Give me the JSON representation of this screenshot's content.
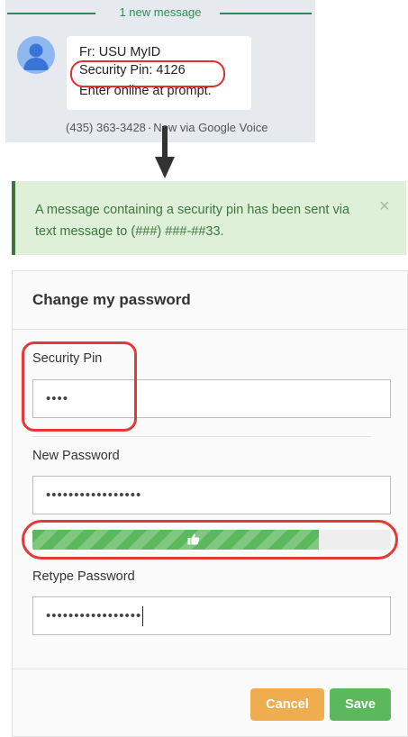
{
  "sms": {
    "header": "1 new message",
    "lines": [
      "Fr: USU MyID",
      "Security Pin: 4126",
      "Enter online at prompt."
    ],
    "phone": "(435) 363-3428",
    "time": "Now via Google Voice"
  },
  "alert": {
    "message": "A message containing a security pin has been sent via text message to (###) ###-##33.",
    "close": "×",
    "color": "#dff0d8"
  },
  "form": {
    "title": "Change my password",
    "pin_label": "Security Pin",
    "pin_value": "••••",
    "new_label": "New Password",
    "new_value": "•••••••••••••••••",
    "retype_label": "Retype Password",
    "retype_value": "•••••••••••••••••",
    "strength_fraction": 0.8,
    "strength_icon": "thumbs-up-icon",
    "cancel": "Cancel",
    "save": "Save"
  },
  "colors": {
    "success": "#5cb85c",
    "warning": "#f0ad4e",
    "highlight": "#e53935"
  }
}
